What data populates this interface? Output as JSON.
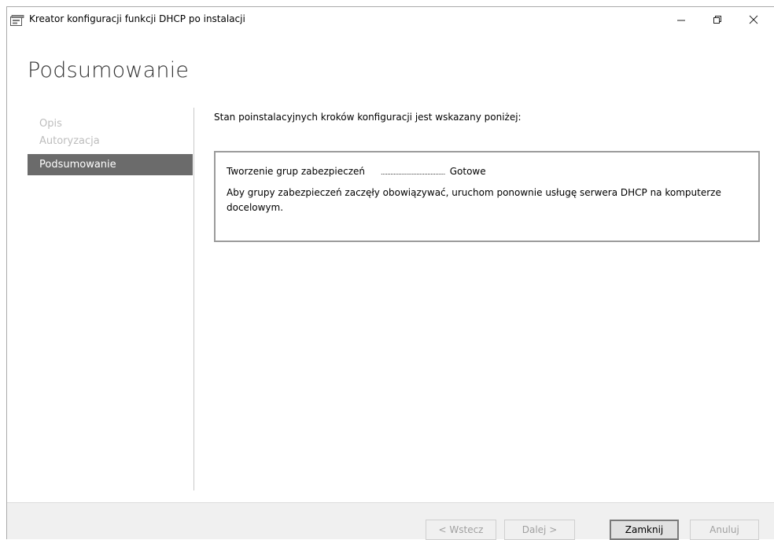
{
  "window": {
    "title": "Kreator konfiguracji funkcji DHCP po instalacji",
    "controls": {
      "minimize": "—",
      "restore": "🗗",
      "close": "✕"
    }
  },
  "page": {
    "title": "Podsumowanie"
  },
  "nav": {
    "items": [
      {
        "label": "Opis",
        "active": false
      },
      {
        "label": "Autoryzacja",
        "active": false
      },
      {
        "label": "Podsumowanie",
        "active": true
      }
    ]
  },
  "main": {
    "status_label": "Stan poinstalacyjnych kroków konfiguracji jest wskazany poniżej:",
    "task": {
      "name": "Tworzenie grup zabezpieczeń",
      "dots": "........................................",
      "status": "Gotowe",
      "message": "Aby grupy zabezpieczeń zaczęły obowiązywać, uruchom ponownie usługę serwera DHCP na komputerze docelowym."
    }
  },
  "footer": {
    "back_label": "< Wstecz",
    "next_label": "Dalej >",
    "close_label": "Zamknij",
    "cancel_label": "Anuluj"
  }
}
